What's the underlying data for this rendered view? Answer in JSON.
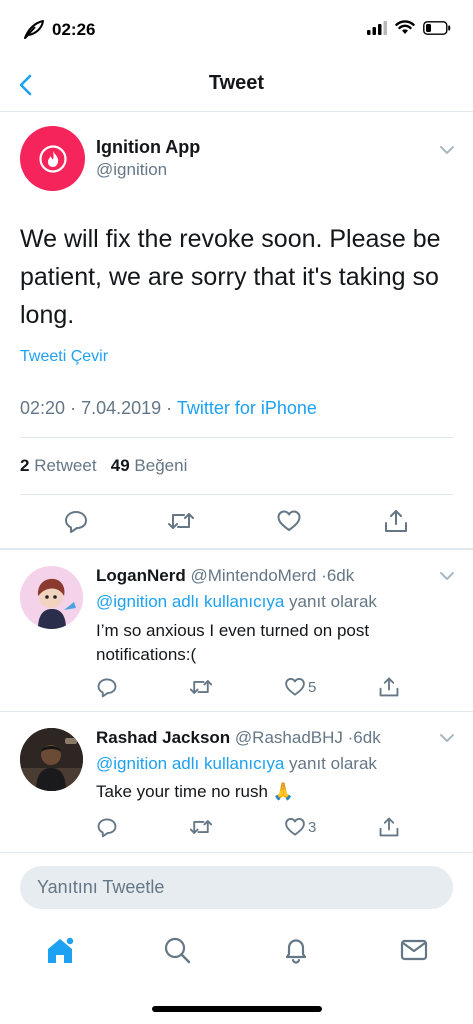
{
  "status": {
    "time": "02:26"
  },
  "nav": {
    "title": "Tweet"
  },
  "tweet": {
    "author_name": "Ignition App",
    "author_handle": "@ignition",
    "text": "We will fix the revoke soon. Please be patient, we are sorry that it's taking so long.",
    "translate_label": "Tweeti Çevir",
    "time": "02:20",
    "date": "7.04.2019",
    "source": "Twitter for iPhone",
    "retweet_count": "2",
    "retweet_label": "Retweet",
    "like_count": "49",
    "like_label": "Beğeni"
  },
  "replies": [
    {
      "name": "LoganNerd",
      "handle": "@MintendoMerd",
      "age": "6dk",
      "reply_to_link": "@ignition adlı kullanıcıya",
      "reply_to_suffix": "yanıt olarak",
      "text": "I’m so anxious I even turned on post notifications:(",
      "likes": "5"
    },
    {
      "name": "Rashad Jackson",
      "handle": "@RashadBHJ",
      "age": "6dk",
      "reply_to_link": "@ignition adlı kullanıcıya",
      "reply_to_suffix": "yanıt olarak",
      "text": "Take your time no rush 🙏",
      "likes": "3"
    }
  ],
  "compose": {
    "placeholder": "Yanıtını Tweetle"
  },
  "icons": {
    "accent": "#1da1f2",
    "brand_red": "#f5245a",
    "tabs": [
      "home-icon",
      "search-icon",
      "notifications-icon",
      "messages-icon"
    ]
  }
}
